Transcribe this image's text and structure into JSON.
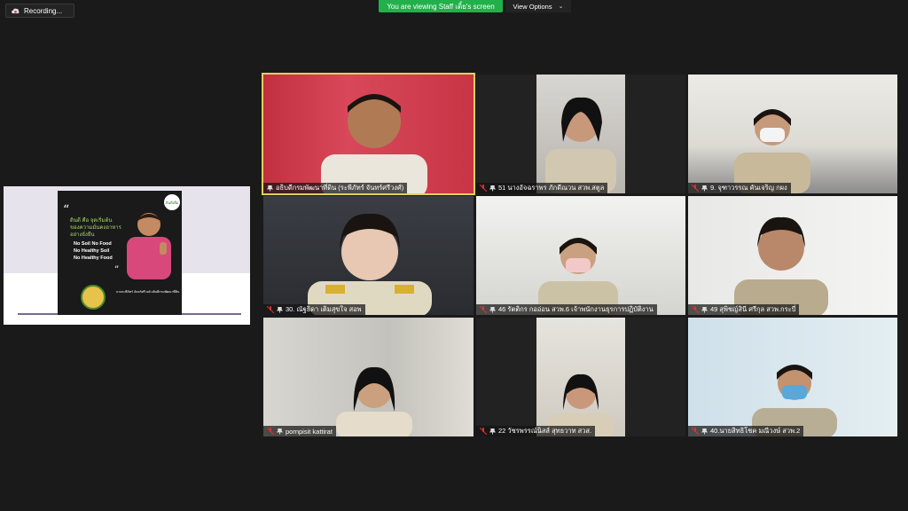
{
  "recording": {
    "label": "Recording..."
  },
  "banner": {
    "viewing_text": "You are viewing Staff  เติ้ย's screen"
  },
  "view_options": {
    "label": "View Options",
    "chevron": "chevron-down-icon"
  },
  "shared_screen": {
    "poster": {
      "thai_headline": [
        "ดินดี คือ จุดเริ่มต้น",
        "ของความมั่นคงอาหาร",
        "อย่างยั่งยืน"
      ],
      "english_lines": [
        "No Soil No Food",
        "No Healthy Soil",
        "No Healthy Food"
      ],
      "logo_text": "ดินดีเพื่อ",
      "caption": "นายระพีภัทร์ จันทร์ศรีวงศ์ อธิบดีกรมพัฒนาที่ดิน"
    }
  },
  "participants": [
    {
      "name": "อธิบดีกรมพัฒนาที่ดิน (ระพีภัทร์ จันทร์ศรีวงศ์)",
      "muted": false,
      "active": true
    },
    {
      "name": "51 นางอัจฉราพร ภักดีณวน สวพ.สตูล",
      "muted": true,
      "active": false
    },
    {
      "name": "9. จุฑาวรรณ คันเจริญ กผง",
      "muted": true,
      "active": false
    },
    {
      "name": "30. ณัฐธิดา เติมสุขใจ สอพ",
      "muted": true,
      "active": false
    },
    {
      "name": "46 รัตติกร  กออ่อน สวพ.6 เจ้าพนักงานธุรการปฏิบัติงาน",
      "muted": true,
      "active": false
    },
    {
      "name": "49 สุพิชญ์สินี ศรีกุล สวพ.กระบี่",
      "muted": true,
      "active": false
    },
    {
      "name": "pornpisit kattirat",
      "muted": true,
      "active": false
    },
    {
      "name": "22 วัชรพรรณ์นิสส์ สุทธวาท สวส.",
      "muted": true,
      "active": false
    },
    {
      "name": "40.นายสิทธิโชค มณีวงษ์ สวพ.2",
      "muted": true,
      "active": false
    }
  ]
}
